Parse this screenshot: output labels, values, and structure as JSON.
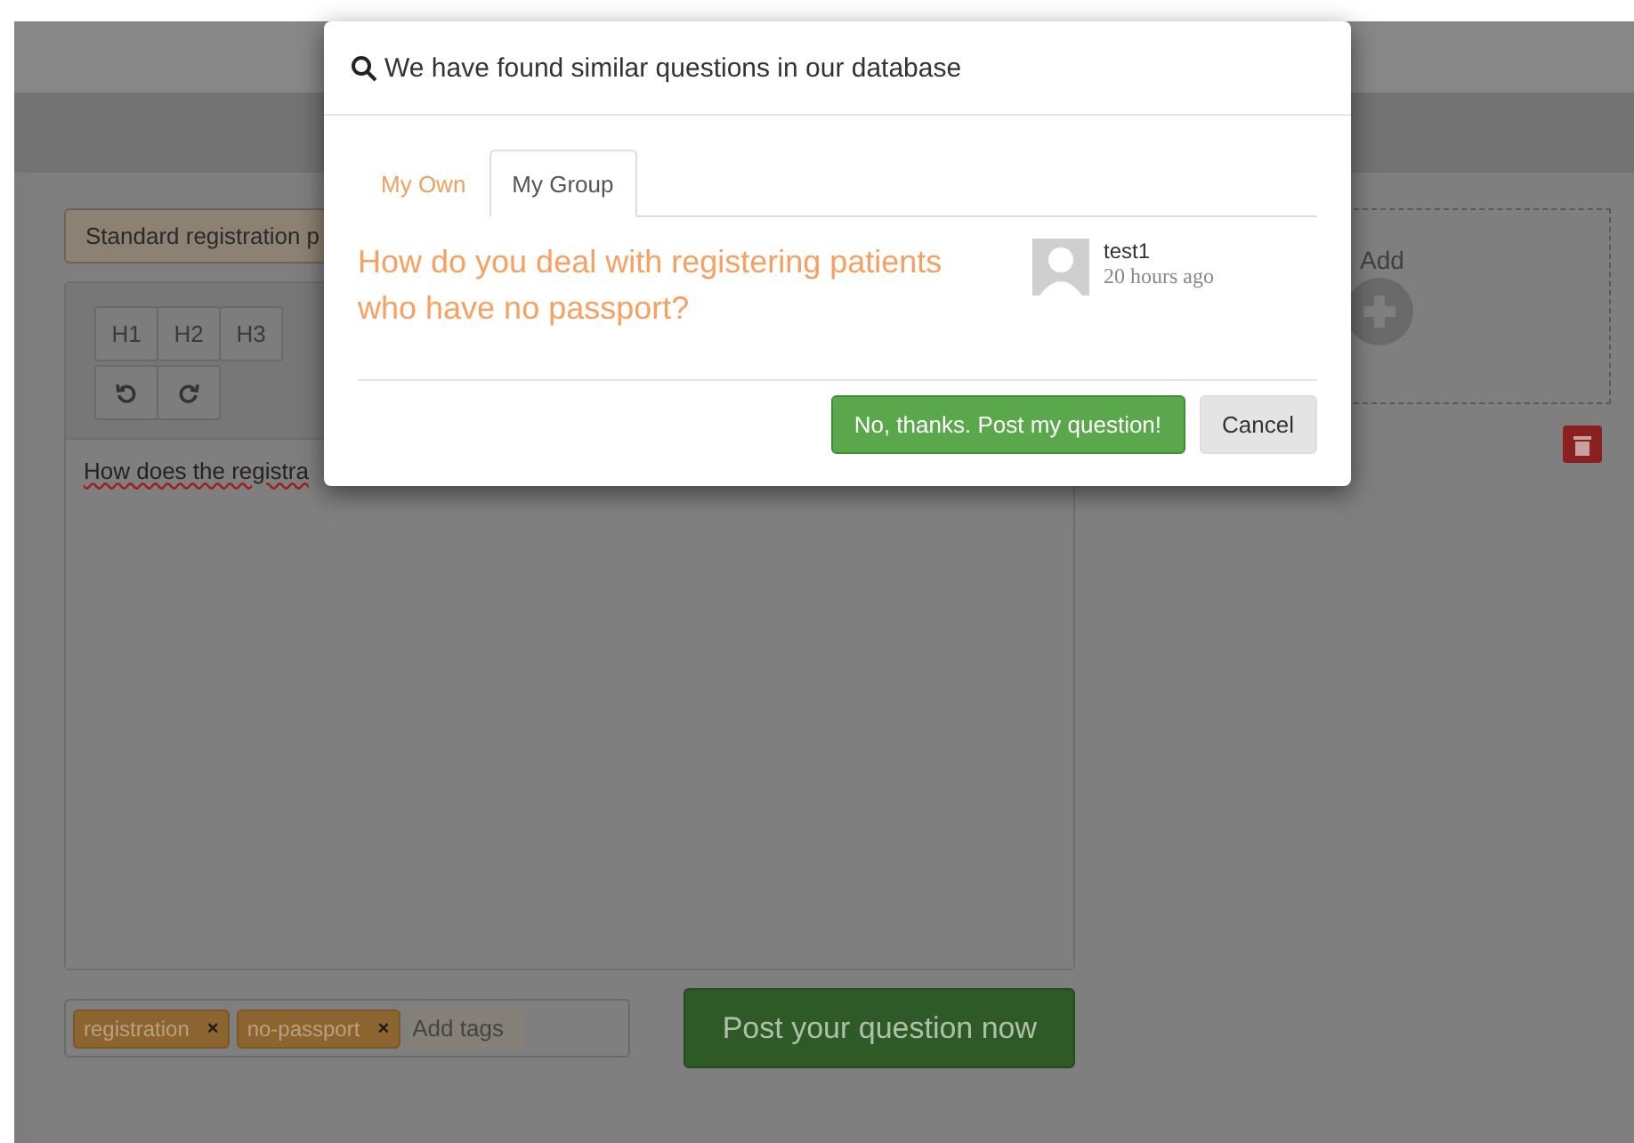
{
  "page": {
    "title_field": {
      "value": "Standard registration p"
    },
    "editor": {
      "toolbar": [
        {
          "label": "H1"
        },
        {
          "label": "H2"
        },
        {
          "label": "H3"
        }
      ],
      "history": [
        {
          "kind": "undo"
        },
        {
          "kind": "redo"
        }
      ],
      "text": "How does the registra"
    },
    "tags": [
      {
        "label": "registration",
        "remove": "×"
      },
      {
        "label": "no-passport",
        "remove": "×"
      }
    ],
    "tag_input": {
      "placeholder": "Add tags"
    },
    "post_button": "Post your question now",
    "attachment": {
      "label": "Add"
    }
  },
  "dialog": {
    "title": "We have found similar questions in our database",
    "tabs": [
      {
        "label": "My Own",
        "selected": false
      },
      {
        "label": "My Group",
        "selected": true
      }
    ],
    "results": [
      {
        "question": "How do you deal with registering patients who have no passport?",
        "author": "test1",
        "time": "20 hours ago"
      }
    ],
    "buttons": [
      {
        "label": "No, thanks. Post my question!",
        "kind": "primary"
      },
      {
        "label": "Cancel",
        "kind": "default"
      }
    ]
  }
}
